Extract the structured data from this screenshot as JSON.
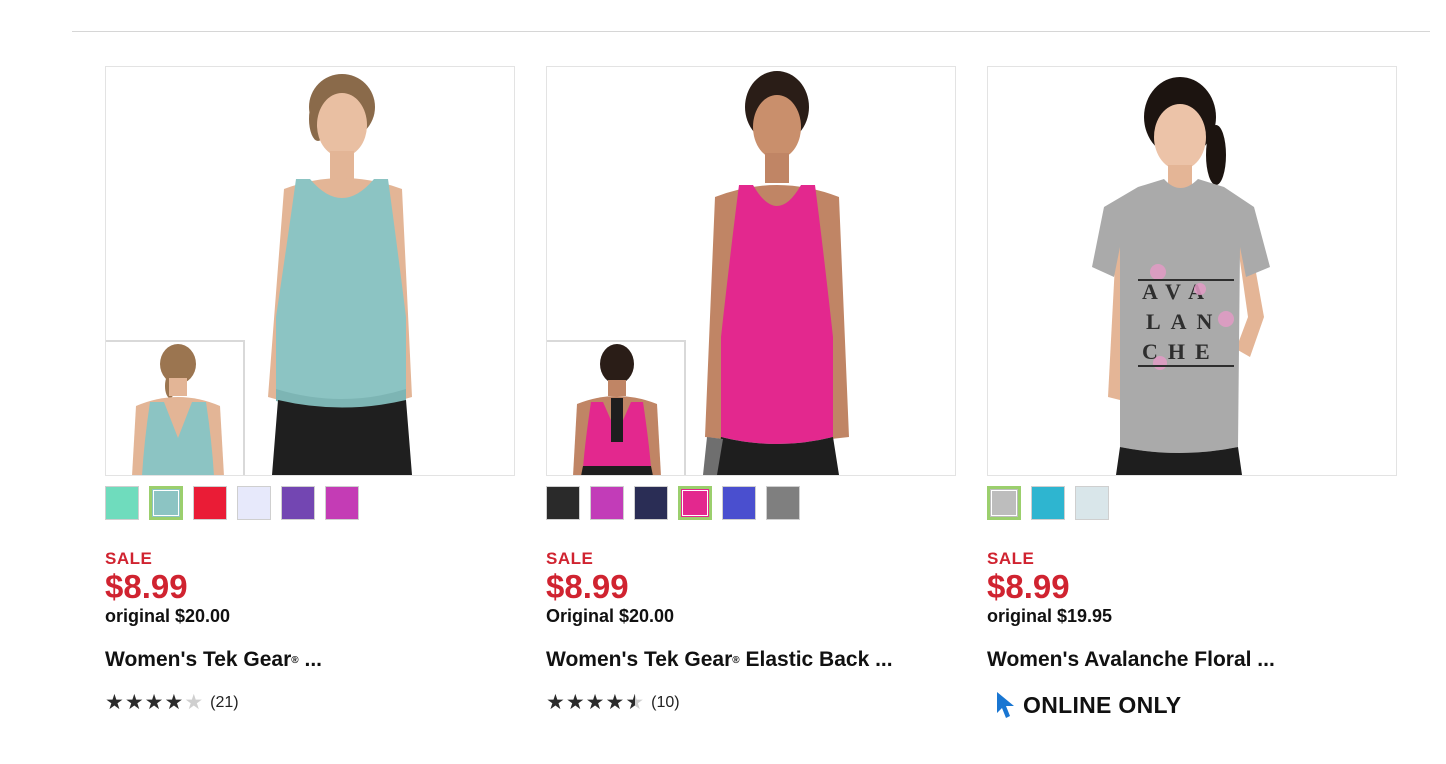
{
  "products": [
    {
      "sale_label": "SALE",
      "sale_price": "$8.99",
      "original_price": "original $20.00",
      "title_prefix": "Women's Tek Gear",
      "title_suffix": " ...",
      "reg_mark": "®",
      "stars": 4,
      "rating_count": "(21)",
      "swatch_colors": [
        "#6fdcbd",
        "#8cc4c3",
        "#ea1c36",
        "#e7e9fb",
        "#7346b2",
        "#c43cb5"
      ],
      "selected_swatch": 1
    },
    {
      "sale_label": "SALE",
      "sale_price": "$8.99",
      "original_price": "Original $20.00",
      "title_prefix": "Women's Tek Gear",
      "title_suffix": " Elastic Back ...",
      "reg_mark": "®",
      "stars": 4.5,
      "rating_count": "(10)",
      "swatch_colors": [
        "#2a2a2a",
        "#c23cb8",
        "#2a2d55",
        "#e3288e",
        "#4a4fcf",
        "#7f7f7f"
      ],
      "selected_swatch": 3
    },
    {
      "sale_label": "SALE",
      "sale_price": "$8.99",
      "original_price": "original $19.95",
      "title": "Women's Avalanche Floral ...",
      "online_only": "ONLINE ONLY",
      "graphic_text": [
        "AVA",
        "LAN",
        "CHE"
      ],
      "swatch_colors": [
        "#bdbdbd",
        "#2eb5d0",
        "#d9e6ea"
      ],
      "selected_swatch": 0
    }
  ],
  "colors": {
    "sale": "#d02330",
    "selected_border": "#9bcf6d",
    "online_icon": "#1976d2"
  }
}
